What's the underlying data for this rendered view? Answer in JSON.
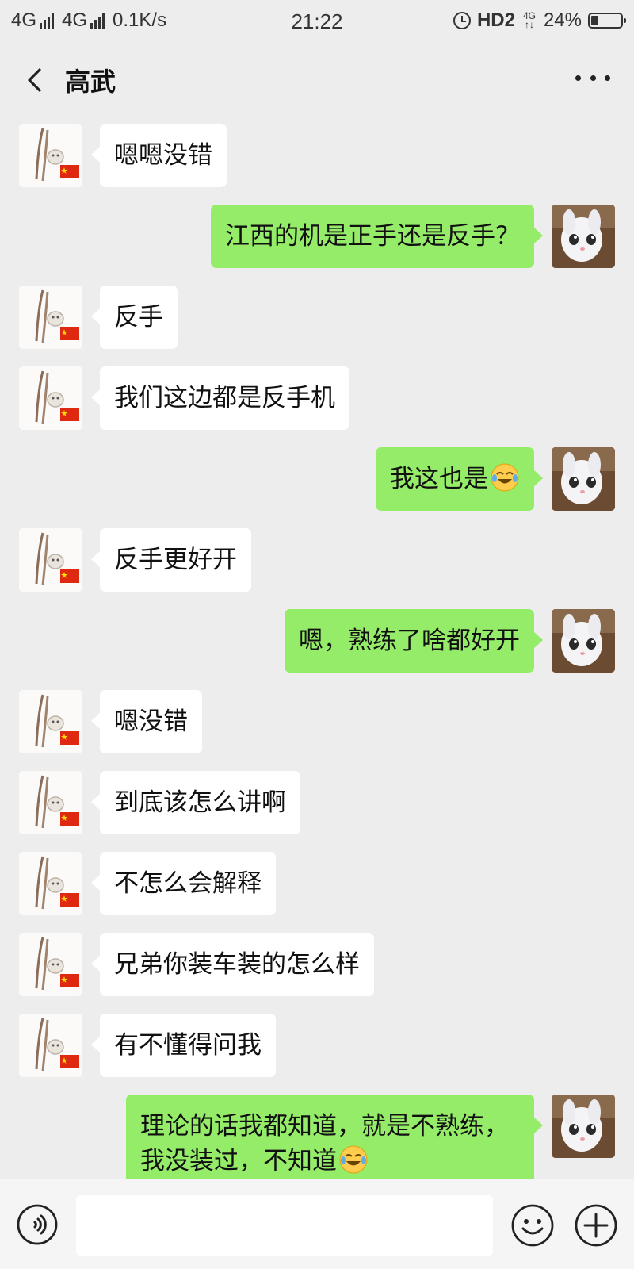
{
  "status_bar": {
    "network_1": "4G",
    "network_2": "4G",
    "speed": "0.1K/s",
    "time": "21:22",
    "hd": "HD2",
    "small_net_top": "4G",
    "small_net_bottom": "↑↓",
    "battery_text": "24%",
    "battery_level": 0.24
  },
  "header": {
    "title": "高武"
  },
  "messages": [
    {
      "side": "left",
      "text": "嗯嗯没错"
    },
    {
      "side": "right",
      "text": "江西的机是正手还是反手？"
    },
    {
      "side": "left",
      "text": "反手"
    },
    {
      "side": "left",
      "text": "我们这边都是反手机"
    },
    {
      "side": "right",
      "text": "我这也是",
      "emoji": "laughing-crying-emoji"
    },
    {
      "side": "left",
      "text": "反手更好开"
    },
    {
      "side": "right",
      "text": "嗯，熟练了啥都好开"
    },
    {
      "side": "left",
      "text": "嗯没错"
    },
    {
      "side": "left",
      "text": "到底该怎么讲啊"
    },
    {
      "side": "left",
      "text": "不怎么会解释"
    },
    {
      "side": "left",
      "text": "兄弟你装车装的怎么样"
    },
    {
      "side": "left",
      "text": "有不懂得问我"
    },
    {
      "side": "right",
      "text": "理论的话我都知道，就是不熟练，我没装过，不知道",
      "emoji": "laughing-crying-emoji"
    }
  ],
  "input_bar": {
    "value": "",
    "placeholder": ""
  },
  "colors": {
    "background": "#ededed",
    "sent_bubble": "#95ec69",
    "received_bubble": "#ffffff"
  }
}
